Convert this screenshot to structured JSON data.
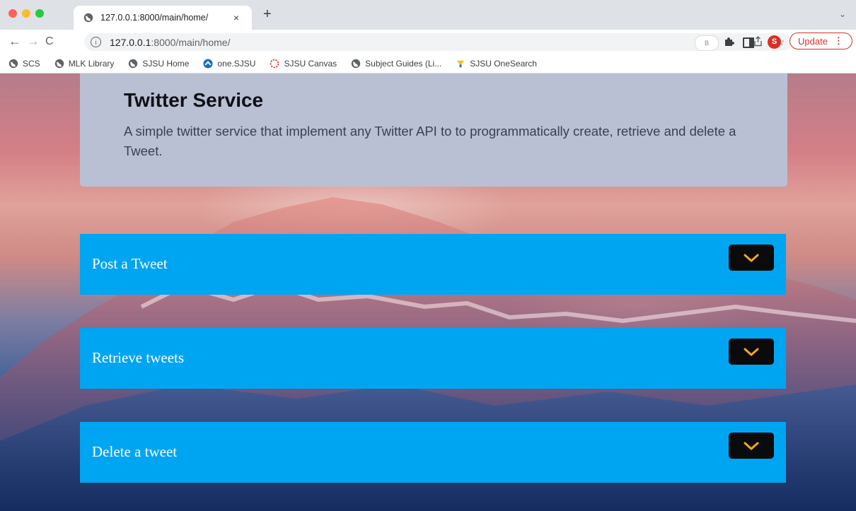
{
  "browser": {
    "tab_title": "127.0.0.1:8000/main/home/",
    "tab_close": "×",
    "new_tab": "+",
    "tab_search": "⌄",
    "url_host": "127.0.0.1",
    "url_rest": ":8000/main/home/",
    "extension_badge": "B",
    "profile_initial": "S",
    "update_label": "Update",
    "update_menu": "⋮"
  },
  "bookmarks": [
    {
      "label": "SCS",
      "icon": "globe-icon"
    },
    {
      "label": "MLK Library",
      "icon": "globe-icon"
    },
    {
      "label": "SJSU Home",
      "icon": "globe-icon"
    },
    {
      "label": "one.SJSU",
      "icon": "one-sjsu-icon"
    },
    {
      "label": "SJSU Canvas",
      "icon": "canvas-icon"
    },
    {
      "label": "Subject Guides (Li...",
      "icon": "globe-icon"
    },
    {
      "label": "SJSU OneSearch",
      "icon": "onesearch-icon"
    }
  ],
  "hero": {
    "title": "Twitter Service",
    "description": "A simple twitter service that implement any Twitter API to to programmatically create, retrieve and delete a Tweet."
  },
  "panels": [
    {
      "title": "Post a Tweet"
    },
    {
      "title": "Retrieve tweets"
    },
    {
      "title": "Delete a tweet"
    }
  ],
  "colors": {
    "panel": "#00a5f2",
    "hero": "#b9c0d4",
    "toggle_bg": "#0b0b0b",
    "chevron": "#f5a623"
  }
}
